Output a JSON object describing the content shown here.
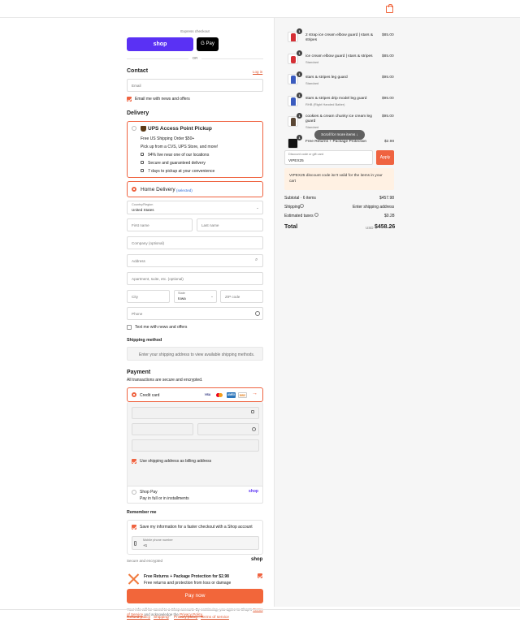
{
  "header": {
    "cart_icon": "shopping-bag-icon",
    "accent": "#ef6340"
  },
  "express": {
    "label": "Express checkout",
    "shop_label": "shop",
    "gpay_label": "G Pay",
    "or_label": "OR"
  },
  "contact": {
    "title": "Contact",
    "login_label": "Log in",
    "email_placeholder": "Email",
    "news_label": "Email me with news and offers"
  },
  "delivery": {
    "title": "Delivery",
    "ups_title": "UPS Access Point Pickup",
    "ups_line1": "Free US Shipping Order $50+",
    "ups_line2": "Pick up from a CVS, UPS Store, and more!",
    "ups_bullets": [
      "94% live near one of our locations",
      "Secure and guaranteed delivery",
      "7 days to pickup at your convenience"
    ],
    "home_title": "Home Delivery",
    "home_selected": "(selected)",
    "country_label": "Country/Region",
    "country_value": "United States",
    "first_name": "First name",
    "last_name": "Last name",
    "company": "Company (optional)",
    "address": "Address",
    "apartment": "Apartment, suite, etc. (optional)",
    "city": "City",
    "state_label": "State",
    "state_value": "Iowa",
    "zip": "ZIP code",
    "phone": "Phone",
    "text_news": "Text me with news and offers"
  },
  "shipping_method": {
    "title": "Shipping method",
    "message": "Enter your shipping address to view available shipping methods."
  },
  "payment": {
    "title": "Payment",
    "subtitle": "All transactions are secure and encrypted.",
    "credit_card_label": "Credit card",
    "card_brands": [
      "VISA",
      "MC",
      "AMEX",
      "DISC"
    ],
    "billing_label": "Use shipping address as billing address",
    "shop_pay_label": "Shop Pay",
    "shop_pay_sub": "Pay in full or in installments",
    "shop_pay_logo": "shop"
  },
  "remember": {
    "title": "Remember me",
    "save_label": "Save my information for a faster checkout with a Shop account",
    "mobile_label": "Mobile phone number",
    "mobile_value": "+1",
    "secure_label": "Secure and encrypted",
    "shop_logo": "shop"
  },
  "protection": {
    "title": "Free Returns + Package Protection for $2.98",
    "subtitle": "Free returns and protection from loss or damage"
  },
  "pay_now": "Pay now",
  "legal": {
    "text_before": "Your info will be saved to a Shop account. By continuing, you agree to Shop's",
    "terms": "Terms of Service",
    "and_text": "and acknowledge the",
    "privacy": "Privacy Policy."
  },
  "footer": [
    "Refund policy",
    "Shipping",
    "Privacy policy",
    "Terms of service"
  ],
  "summary": {
    "items": [
      {
        "qty": "1",
        "title": "2 strap ice cream elbow guard | stars & stripes",
        "variant": "",
        "price": "$85.00"
      },
      {
        "qty": "1",
        "title": "ice cream elbow guard | stars & stripes",
        "variant": "Standard",
        "price": "$85.00"
      },
      {
        "qty": "1",
        "title": "stars & stripes leg guard",
        "variant": "Standard",
        "price": "$95.00"
      },
      {
        "qty": "1",
        "title": "stars & stripes drip model leg guard",
        "variant": "RHB (Right Handed Batter)",
        "price": "$95.00"
      },
      {
        "qty": "1",
        "title": "cookies & cream chunky ice cream leg guard",
        "variant": "Standard",
        "price": "$95.00"
      },
      {
        "qty": "1",
        "title": "Free Returns + Package Protection",
        "variant": "",
        "price": "$2.98"
      }
    ],
    "scroll_label": "Scroll for more items ↓",
    "discount_label": "Discount code or gift card",
    "discount_value": "VIPEX25",
    "apply_label": "Apply",
    "error_text": "VIPEX25 discount code isn't valid for the items in your cart",
    "subtotal_label": "Subtotal · 6 items",
    "subtotal_value": "$457.98",
    "shipping_label": "Shipping",
    "shipping_value": "Enter shipping address",
    "tax_label": "Estimated taxes",
    "tax_value": "$0.28",
    "total_label": "Total",
    "currency": "USD",
    "total_value": "$458.26"
  }
}
